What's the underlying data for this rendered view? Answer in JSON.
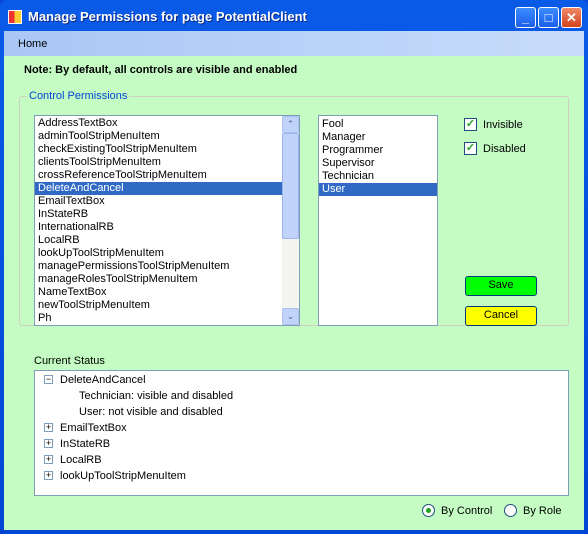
{
  "window": {
    "title": "Manage Permissions for page PotentialClient"
  },
  "menu": {
    "home": "Home"
  },
  "note": "Note: By default, all controls are visible and enabled",
  "group": {
    "label": "Control Permissions"
  },
  "controls": [
    "AddressTextBox",
    "adminToolStripMenuItem",
    "checkExistingToolStripMenuItem",
    "clientsToolStripMenuItem",
    "crossReferenceToolStripMenuItem",
    "DeleteAndCancel",
    "EmailTextBox",
    "InStateRB",
    "InternationalRB",
    "LocalRB",
    "lookUpToolStripMenuItem",
    "managePermissionsToolStripMenuItem",
    "manageRolesToolStripMenuItem",
    "NameTextBox",
    "newToolStripMenuItem",
    "Ph"
  ],
  "selected_control": "DeleteAndCancel",
  "roles": [
    "Fool",
    "Manager",
    "Programmer",
    "Supervisor",
    "Technician",
    "User"
  ],
  "selected_role": "User",
  "checkboxes": {
    "invisible": {
      "label": "Invisible",
      "checked": true
    },
    "disabled": {
      "label": "Disabled",
      "checked": true
    }
  },
  "buttons": {
    "save": "Save",
    "cancel": "Cancel",
    "save_color": "#00ff00",
    "cancel_color": "#ffff00"
  },
  "status": {
    "label": "Current Status",
    "tree": [
      {
        "label": "DeleteAndCancel",
        "expanded": true,
        "children": [
          "Technician: visible  and  disabled",
          "User: not visible  and  disabled"
        ]
      },
      {
        "label": "EmailTextBox",
        "expanded": false
      },
      {
        "label": "InStateRB",
        "expanded": false
      },
      {
        "label": "LocalRB",
        "expanded": false
      },
      {
        "label": "lookUpToolStripMenuItem",
        "expanded": false
      }
    ]
  },
  "view": {
    "by_control": "By Control",
    "by_role": "By Role",
    "selected": "by_control"
  }
}
